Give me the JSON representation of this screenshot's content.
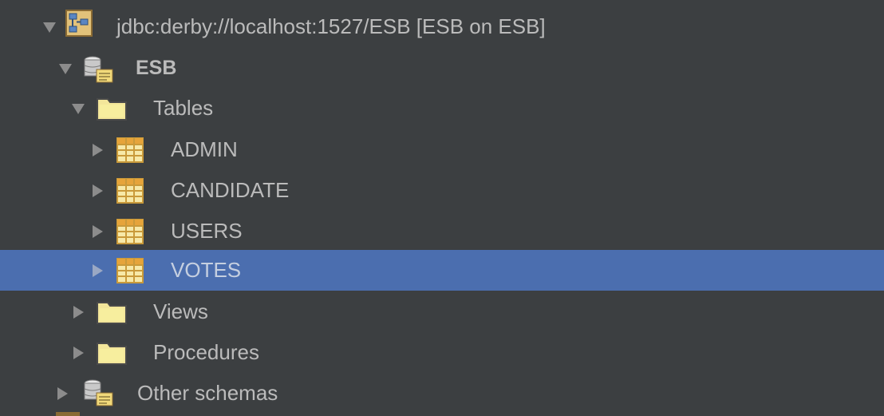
{
  "tree": {
    "connection": {
      "label": "jdbc:derby://localhost:1527/ESB [ESB on ESB]",
      "expanded": true,
      "icon": "connection-icon"
    },
    "schema": {
      "label": "ESB",
      "expanded": true,
      "icon": "schema-icon"
    },
    "tables_folder": {
      "label": "Tables",
      "expanded": true,
      "icon": "folder-icon"
    },
    "tables": [
      {
        "label": "ADMIN",
        "icon": "table-icon",
        "expanded": false
      },
      {
        "label": "CANDIDATE",
        "icon": "table-icon",
        "expanded": false
      },
      {
        "label": "USERS",
        "icon": "table-icon",
        "expanded": false
      },
      {
        "label": "VOTES",
        "icon": "table-icon",
        "expanded": false,
        "selected": true
      }
    ],
    "views_folder": {
      "label": "Views",
      "expanded": false,
      "icon": "folder-icon"
    },
    "procedures_folder": {
      "label": "Procedures",
      "expanded": false,
      "icon": "folder-icon"
    },
    "other_schemas": {
      "label": "Other schemas",
      "expanded": false,
      "icon": "schema-icon"
    }
  },
  "colors": {
    "background": "#3c3f41",
    "selection": "#4b6eaf",
    "text": "#bbbbbb",
    "folder": "#f0e08a"
  }
}
